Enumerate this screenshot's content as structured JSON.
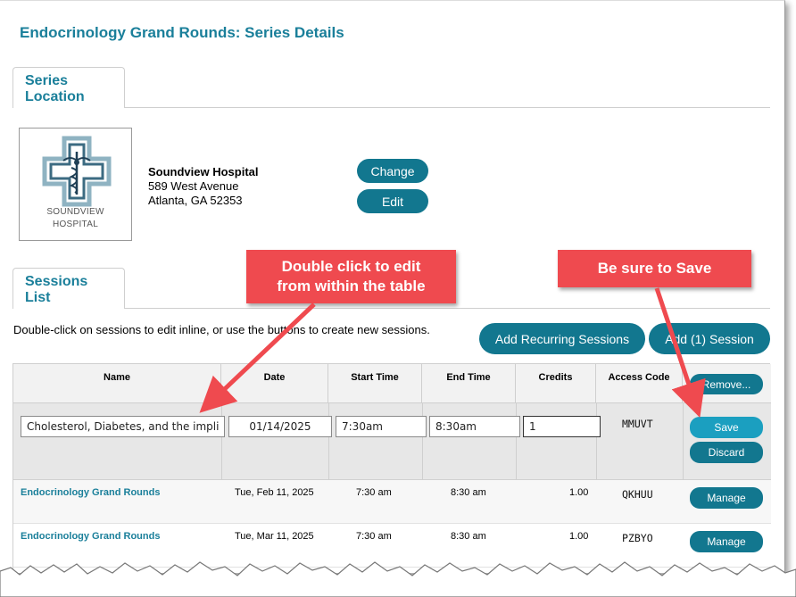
{
  "page_title": "Endocrinology Grand Rounds: Series Details",
  "tabs": {
    "series_location_line1": "Series",
    "series_location_line2": "Location",
    "sessions_list_line1": "Sessions",
    "sessions_list_line2": "List"
  },
  "location": {
    "logo_text_line1": "SOUNDVIEW",
    "logo_text_line2": "HOSPITAL",
    "name": "Soundview Hospital",
    "address_line1": "589 West Avenue",
    "address_line2": "Atlanta, GA 52353",
    "change_label": "Change",
    "edit_label": "Edit"
  },
  "sessions": {
    "instruction": "Double-click on sessions to edit inline, or use the buttons to create new sessions.",
    "add_recurring_label": "Add Recurring Sessions",
    "add_one_label": "Add (1) Session",
    "columns": {
      "name": "Name",
      "date": "Date",
      "start": "Start Time",
      "end": "End Time",
      "credits": "Credits",
      "access": "Access Code"
    },
    "remove_label": "Remove...",
    "edit_row": {
      "name": "Cholesterol, Diabetes, and the implic",
      "date": "01/14/2025",
      "start": "7:30am",
      "end": "8:30am",
      "credits": "1",
      "access": "MMUVT",
      "save_label": "Save",
      "discard_label": "Discard"
    },
    "rows": [
      {
        "name": "Endocrinology Grand Rounds",
        "date": "Tue, Feb 11, 2025",
        "start": "7:30 am",
        "end": "8:30 am",
        "credits": "1.00",
        "access": "QKHUU",
        "action": "Manage"
      },
      {
        "name": "Endocrinology Grand Rounds",
        "date": "Tue, Mar 11, 2025",
        "start": "7:30 am",
        "end": "8:30 am",
        "credits": "1.00",
        "access": "PZBYO",
        "action": "Manage"
      }
    ]
  },
  "callouts": {
    "edit_line1": "Double click to edit",
    "edit_line2": "from within the table",
    "save": "Be sure to Save"
  },
  "colors": {
    "accent": "#1a7f9a",
    "button": "#12778f",
    "callout": "#ef4a4f"
  }
}
